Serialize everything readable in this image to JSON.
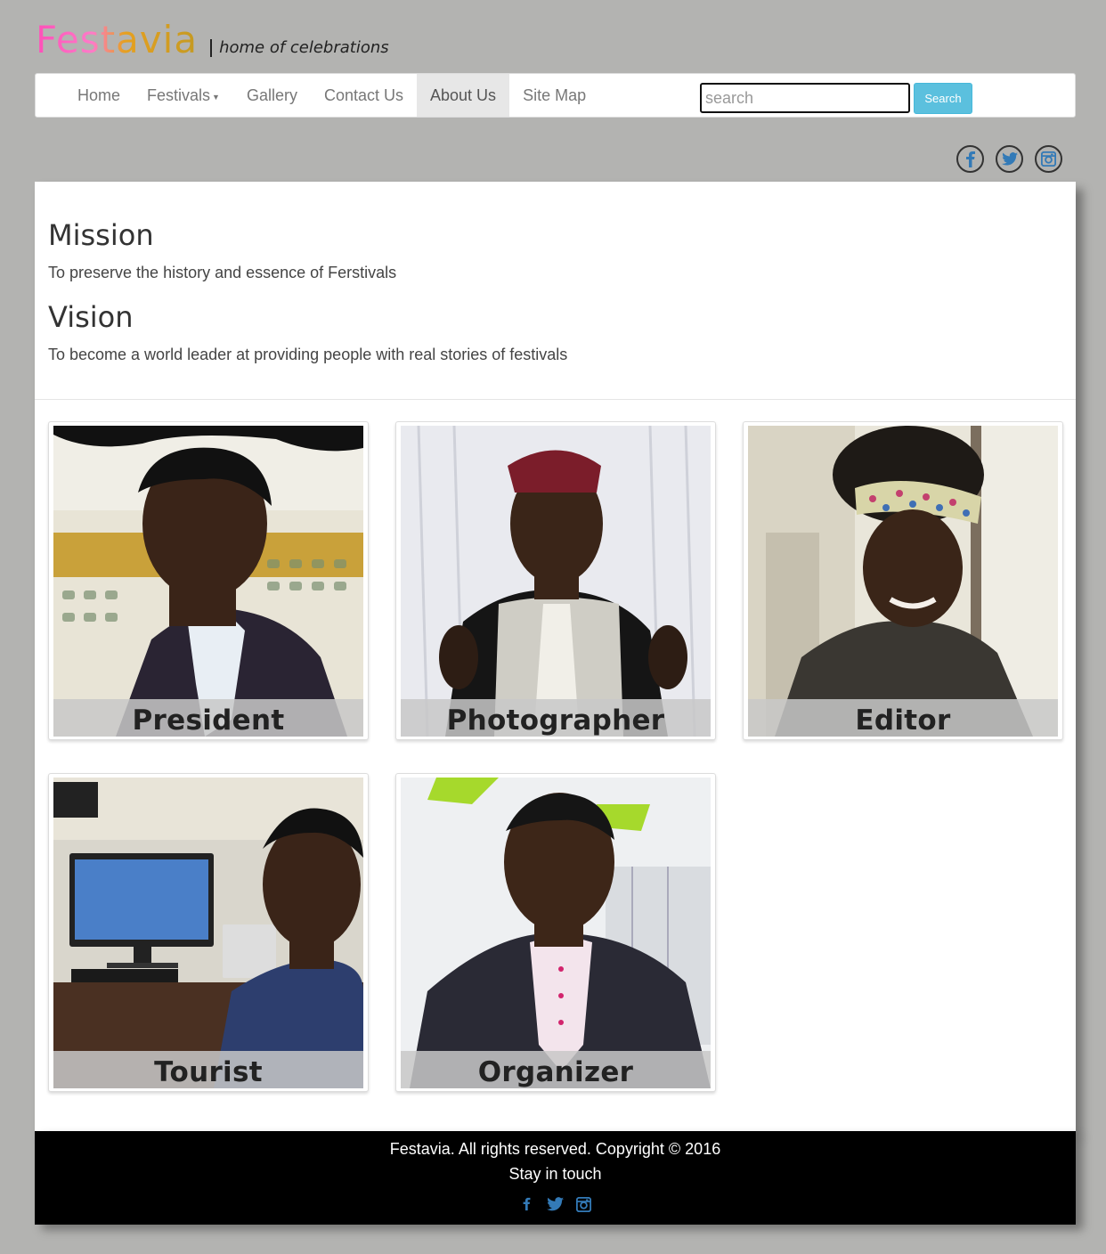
{
  "brand": {
    "logo": "Festavia",
    "tagline": "home of celebrations"
  },
  "nav": {
    "items": [
      {
        "label": "Home"
      },
      {
        "label": "Festivals"
      },
      {
        "label": "Gallery"
      },
      {
        "label": "Contact Us"
      },
      {
        "label": "About Us"
      },
      {
        "label": "Site Map"
      }
    ],
    "active": "About Us",
    "search": {
      "placeholder": "search",
      "button": "Search"
    }
  },
  "social": [
    "facebook-icon",
    "twitter-icon",
    "instagram-icon"
  ],
  "about": {
    "mission_title": "Mission",
    "mission_text": "To preserve the history and essence of Ferstivals",
    "vision_title": "Vision",
    "vision_text": "To become a world leader at providing people with real stories of festivals"
  },
  "team": [
    {
      "role": "President"
    },
    {
      "role": "Photographer"
    },
    {
      "role": "Editor"
    },
    {
      "role": "Tourist"
    },
    {
      "role": "Organizer"
    }
  ],
  "footer": {
    "copyright": "Festavia. All rights reserved. Copyright © 2016",
    "stay": "Stay in touch"
  },
  "colors": {
    "accent": "#5bc0de",
    "social_blue": "#337ab7",
    "page_bg": "#b3b3b1"
  }
}
